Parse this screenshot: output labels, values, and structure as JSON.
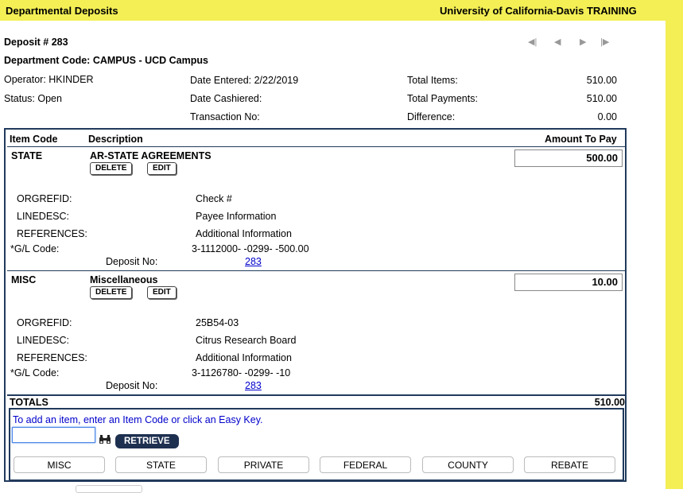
{
  "header": {
    "app_title": "Departmental Deposits",
    "org_title": "University of California-Davis TRAINING"
  },
  "deposit": {
    "number_label": "Deposit # 283",
    "dept_label": "Department Code: CAMPUS - UCD Campus",
    "operator": "Operator: HKINDER",
    "status": "Status: Open",
    "date_entered": "Date Entered: 2/22/2019",
    "date_cashiered": "Date Cashiered:",
    "transaction_no": "Transaction No:",
    "total_items_label": "Total Items:",
    "total_items": "510.00",
    "total_payments_label": "Total Payments:",
    "total_payments": "510.00",
    "difference_label": "Difference:",
    "difference": "0.00"
  },
  "nav": {
    "first": "◀|",
    "prev": "◀",
    "next": "▶",
    "last": "|▶"
  },
  "table": {
    "col_item_code": "Item Code",
    "col_description": "Description",
    "col_amount": "Amount To Pay"
  },
  "items": [
    {
      "code": "STATE",
      "description": "AR-STATE AGREEMENTS",
      "delete_label": "DELETE",
      "edit_label": "EDIT",
      "amount": "500.00",
      "orgrefid_label": "ORGREFID:",
      "orgrefid": "Check #",
      "linedesc_label": "LINEDESC:",
      "linedesc": "Payee Information",
      "references_label": "REFERENCES:",
      "references": "Additional Information",
      "gl_label": "*G/L Code:",
      "gl": "3-1112000- -0299- -500.00",
      "deposit_no_label": "Deposit No:",
      "deposit_no": "283"
    },
    {
      "code": "MISC",
      "description": "Miscellaneous",
      "delete_label": "DELETE",
      "edit_label": "EDIT",
      "amount": "10.00",
      "orgrefid_label": "ORGREFID:",
      "orgrefid": "25B54-03",
      "linedesc_label": "LINEDESC:",
      "linedesc": "Citrus Research Board",
      "references_label": "REFERENCES:",
      "references": "Additional Information",
      "gl_label": "*G/L Code:",
      "gl": "3-1126780- -0299- -10",
      "deposit_no_label": "Deposit No:",
      "deposit_no": "283"
    }
  ],
  "totals": {
    "label": "TOTALS",
    "value": "510.00"
  },
  "add_item": {
    "hint": "To add an item, enter an Item Code or click an Easy Key.",
    "input_value": "",
    "binoculars_icon": "binoculars-icon",
    "retrieve_label": "RETRIEVE"
  },
  "easy_keys": [
    "MISC",
    "STATE",
    "PRIVATE",
    "FEDERAL",
    "COUNTY",
    "REBATE"
  ]
}
